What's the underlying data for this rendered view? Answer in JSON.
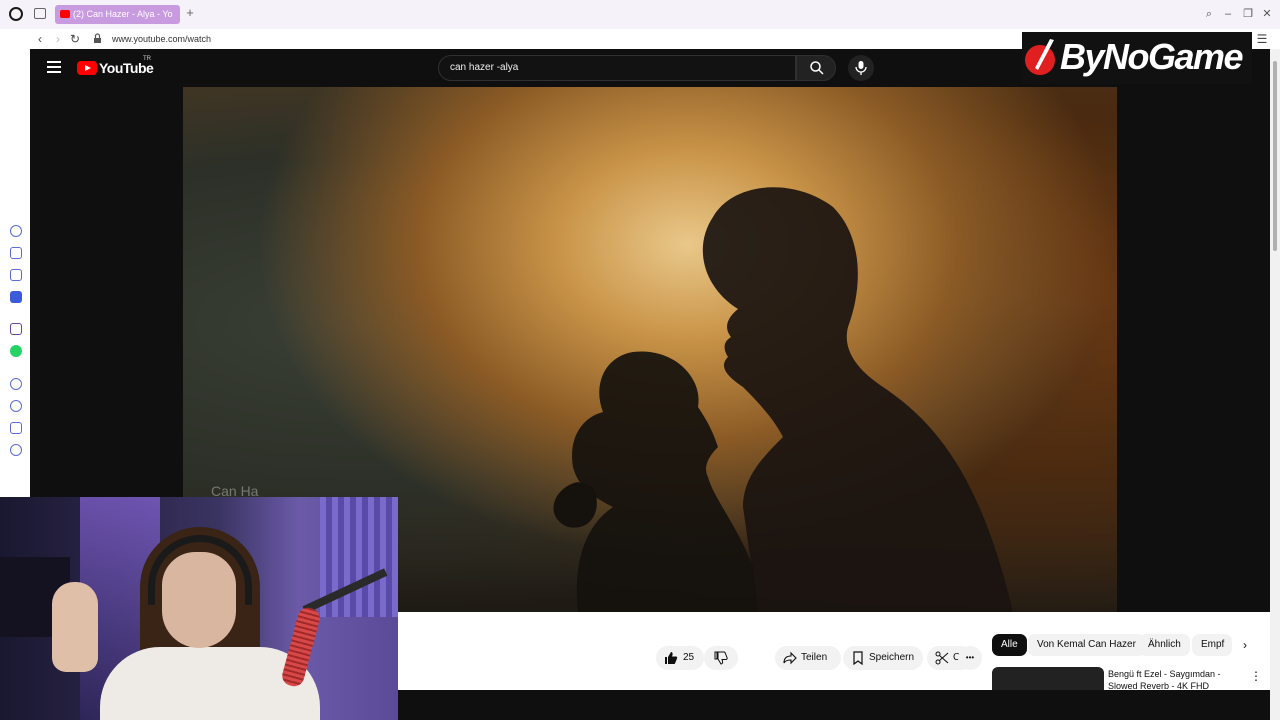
{
  "browser": {
    "tab_title": "(2) Can Hazer - Alya - Yo",
    "url": "www.youtube.com/watch"
  },
  "youtube": {
    "logo_text": "YouTube",
    "country_code": "TR",
    "search_query": "can hazer -alya"
  },
  "video": {
    "overlay_text": "Can Ha"
  },
  "actions": {
    "like_count": "25",
    "share_label": "Teilen",
    "save_label": "Speichern",
    "clip_label": "Clip",
    "more_symbol": "•••"
  },
  "chips": [
    {
      "label": "Alle"
    },
    {
      "label": "Von Kemal Can Hazer"
    },
    {
      "label": "Ähnlich"
    },
    {
      "label": "Empf"
    }
  ],
  "recommendation": {
    "title": "Bengü ft Ezel - Saygımdan - Slowed Reverb - 4K FHD"
  },
  "watermark": {
    "text": "ByNoGame"
  },
  "colors": {
    "youtube_red": "#ff0000",
    "tab_active": "#c89be0",
    "page_dark": "#0f0f0f"
  }
}
